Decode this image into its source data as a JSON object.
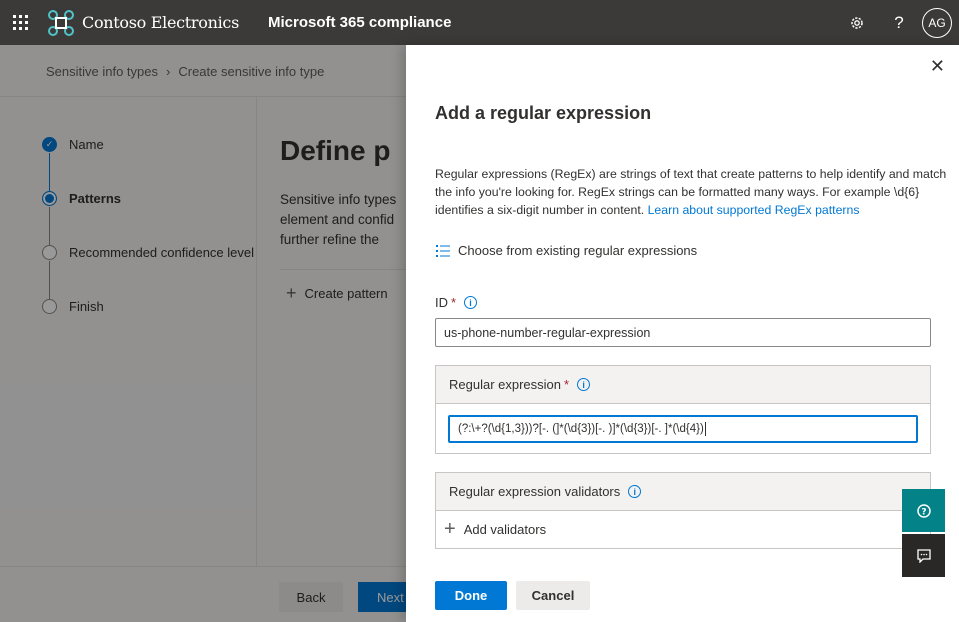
{
  "topbar": {
    "org_name": "Contoso Electronics",
    "app_name": "Microsoft 365 compliance",
    "user_initials": "AG",
    "icons": [
      "waffle-icon",
      "settings-gear-icon",
      "help-question-icon"
    ]
  },
  "breadcrumb": [
    "Sensitive info types",
    "Create sensitive info type"
  ],
  "steps": [
    {
      "label": "Name",
      "state": "done"
    },
    {
      "label": "Patterns",
      "state": "current"
    },
    {
      "label": "Recommended confidence level",
      "state": "pending"
    },
    {
      "label": "Finish",
      "state": "pending"
    }
  ],
  "main": {
    "title": "Define p",
    "desc_lines": [
      "Sensitive info types",
      "element and confid",
      "further refine the"
    ],
    "create_pattern": "Create pattern"
  },
  "footer": {
    "back": "Back",
    "next": "Next"
  },
  "panel": {
    "title": "Add a regular expression",
    "description": "Regular expressions (RegEx) are strings of text that create patterns to help identify and match the info you're looking for. RegEx strings can be formatted many ways. For example \\d{6} identifies a six-digit number in content.",
    "learn_link": "Learn about supported RegEx patterns",
    "choose_existing": "Choose from existing regular expressions",
    "id_label": "ID",
    "required_mark": "*",
    "id_value": "us-phone-number-regular-expression",
    "regex_label": "Regular expression",
    "regex_value": "(?:\\+?(\\d{1,3}))?[-. (]*(\\d{3})[-. )]*(\\d{3})[-. ]*(\\d{4})",
    "validators_label": "Regular expression validators",
    "add_validators": "Add validators",
    "done": "Done",
    "cancel": "Cancel"
  },
  "colors": {
    "accent": "#0078d4",
    "topbar": "#3b3a39",
    "help_fab": "#038387",
    "feedback_fab": "#292827"
  }
}
